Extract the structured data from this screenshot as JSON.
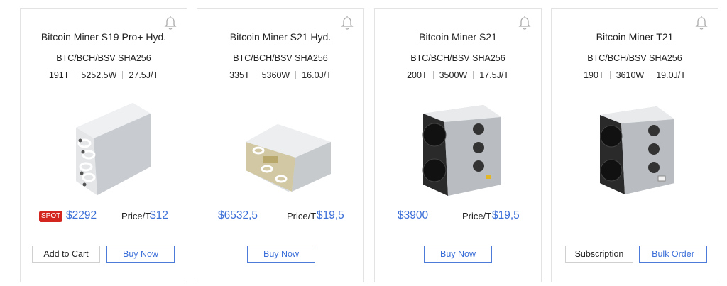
{
  "cards": [
    {
      "name": "Bitcoin Miner S19 Pro+ Hyd.",
      "algo": "BTC/BCH/BSV SHA256",
      "hashrate": "191T",
      "power": "5252.5W",
      "efficiency": "27.5J/T",
      "spot_badge": "SPOT",
      "price": "$2292",
      "price_per_t_label": "Price/T",
      "price_per_t": "$12",
      "buttons": [
        "Add to Cart",
        "Buy Now"
      ]
    },
    {
      "name": "Bitcoin Miner S21 Hyd.",
      "algo": "BTC/BCH/BSV SHA256",
      "hashrate": "335T",
      "power": "5360W",
      "efficiency": "16.0J/T",
      "price": "$6532,5",
      "price_per_t_label": "Price/T",
      "price_per_t": "$19,5",
      "buttons": [
        "Buy Now"
      ]
    },
    {
      "name": "Bitcoin Miner S21",
      "algo": "BTC/BCH/BSV SHA256",
      "hashrate": "200T",
      "power": "3500W",
      "efficiency": "17.5J/T",
      "price": "$3900",
      "price_per_t_label": "Price/T",
      "price_per_t": "$19,5",
      "buttons": [
        "Buy Now"
      ]
    },
    {
      "name": "Bitcoin Miner T21",
      "algo": "BTC/BCH/BSV SHA256",
      "hashrate": "190T",
      "power": "3610W",
      "efficiency": "19.0J/T",
      "buttons": [
        "Subscription",
        "Bulk Order"
      ]
    }
  ],
  "icons": {
    "notify": "bell-icon"
  },
  "colors": {
    "accent": "#3b6fd8",
    "spot_badge": "#d3261e",
    "border": "#e3e3e3"
  }
}
